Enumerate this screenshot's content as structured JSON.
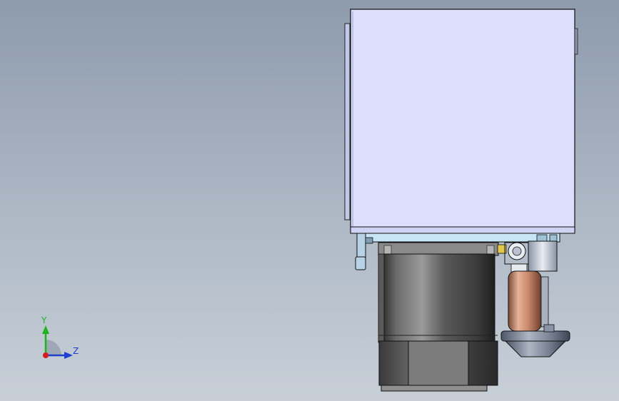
{
  "viewport": {
    "background_top": "#8e9bad",
    "background_bottom": "#c8cfd7"
  },
  "triad": {
    "y_label": "Y",
    "z_label": "Z",
    "y_color": "#1db31d",
    "z_color": "#1f3fd1",
    "x_color": "#d11f1f"
  },
  "model": {
    "enclosure_color": "#dcdffb",
    "motor_color": "#555555",
    "bracket_color": "#c6e6f5",
    "wheel_color": "#d49a7c"
  }
}
